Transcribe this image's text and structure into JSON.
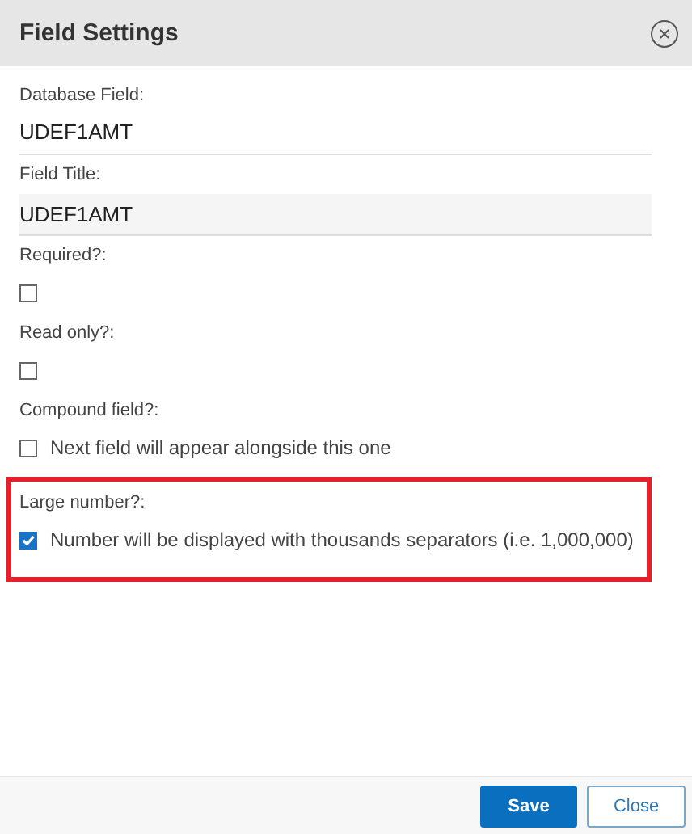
{
  "dialog": {
    "title": "Field Settings"
  },
  "fields": [
    {
      "kind": "text",
      "label": "Database Field:",
      "value": "UDEF1AMT",
      "highlighted": false
    },
    {
      "kind": "input",
      "label": "Field Title:",
      "value": "UDEF1AMT",
      "highlighted": false
    },
    {
      "kind": "checkbox",
      "label": "Required?:",
      "checked": false,
      "highlighted": false
    },
    {
      "kind": "checkbox",
      "label": "Read only?:",
      "checked": false,
      "highlighted": false
    },
    {
      "kind": "checkbox",
      "label": "Compound field?:",
      "checked": false,
      "caption": "Next field will appear alongside this one",
      "highlighted": false
    },
    {
      "kind": "checkbox",
      "label": "Large number?:",
      "checked": true,
      "caption": "Number will be displayed with thousands separators (i.e. 1,000,000)",
      "highlighted": true
    }
  ],
  "buttons": [
    {
      "label": "Save",
      "kind": "primary"
    },
    {
      "label": "Close",
      "kind": "secondary"
    }
  ]
}
